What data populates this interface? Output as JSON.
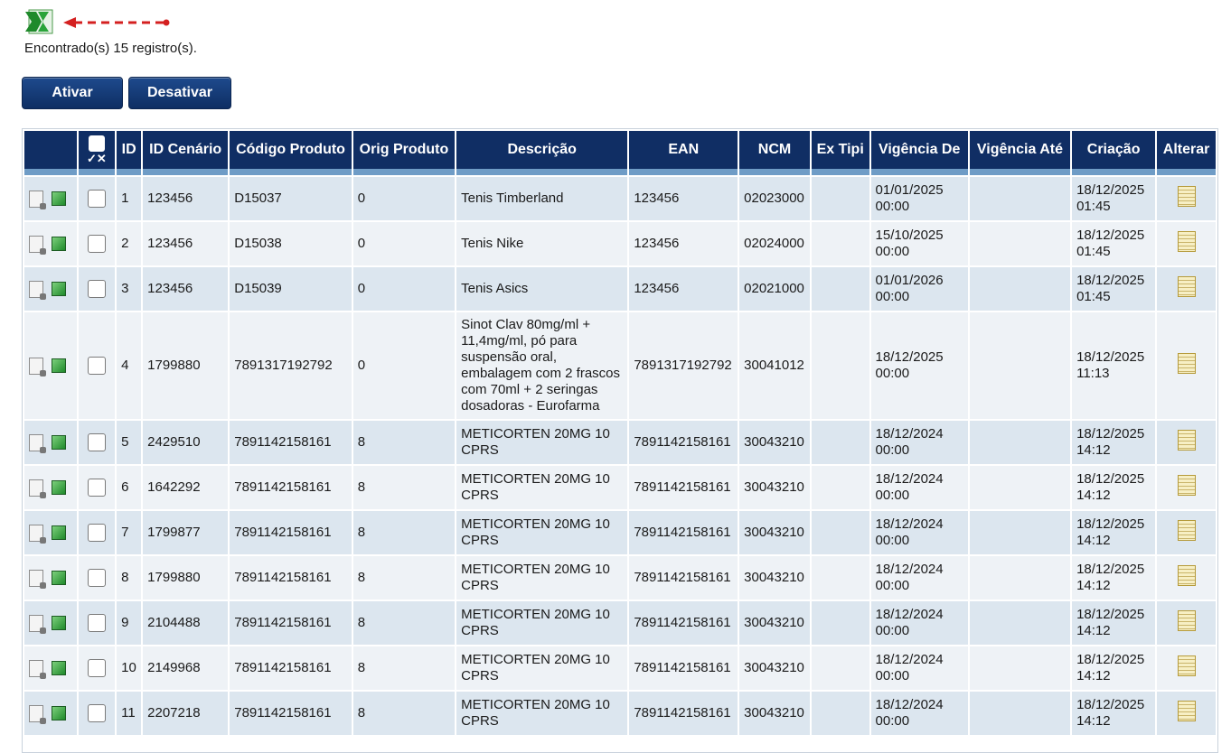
{
  "header": {
    "excel_icon": "excel-icon",
    "arrow_color": "#d42020",
    "found_text": "Encontrado(s) 15 registro(s)."
  },
  "actions": {
    "ativar_label": "Ativar",
    "desativar_label": "Desativar"
  },
  "table": {
    "columns": [
      "ID",
      "ID Cenário",
      "Código Produto",
      "Orig Produto",
      "Descrição",
      "EAN",
      "NCM",
      "Ex Tipi",
      "Vigência De",
      "Vigência Até",
      "Criação",
      "Alterar"
    ],
    "header_check_mark": "✓✕",
    "rows": [
      {
        "id": "1",
        "cenario": "123456",
        "codigo": "D15037",
        "orig": "0",
        "descricao": "Tenis Timberland",
        "ean": "123456",
        "ncm": "02023000",
        "extipi": "",
        "vig_de": "01/01/2025\n00:00",
        "vig_ate": "",
        "criacao": "18/12/2025\n01:45"
      },
      {
        "id": "2",
        "cenario": "123456",
        "codigo": "D15038",
        "orig": "0",
        "descricao": "Tenis Nike",
        "ean": "123456",
        "ncm": "02024000",
        "extipi": "",
        "vig_de": "15/10/2025\n00:00",
        "vig_ate": "",
        "criacao": "18/12/2025\n01:45"
      },
      {
        "id": "3",
        "cenario": "123456",
        "codigo": "D15039",
        "orig": "0",
        "descricao": "Tenis Asics",
        "ean": "123456",
        "ncm": "02021000",
        "extipi": "",
        "vig_de": "01/01/2026\n00:00",
        "vig_ate": "",
        "criacao": "18/12/2025\n01:45"
      },
      {
        "id": "4",
        "cenario": "1799880",
        "codigo": "7891317192792",
        "orig": "0",
        "descricao": "Sinot Clav 80mg/ml + 11,4mg/ml, pó para suspensão oral, embalagem com 2 frascos com 70ml + 2 seringas dosadoras - Eurofarma",
        "ean": "7891317192792",
        "ncm": "30041012",
        "extipi": "",
        "vig_de": "18/12/2025\n00:00",
        "vig_ate": "",
        "criacao": "18/12/2025\n11:13"
      },
      {
        "id": "5",
        "cenario": "2429510",
        "codigo": "7891142158161",
        "orig": "8",
        "descricao": "METICORTEN 20MG 10 CPRS",
        "ean": "7891142158161",
        "ncm": "30043210",
        "extipi": "",
        "vig_de": "18/12/2024\n00:00",
        "vig_ate": "",
        "criacao": "18/12/2025\n14:12"
      },
      {
        "id": "6",
        "cenario": "1642292",
        "codigo": "7891142158161",
        "orig": "8",
        "descricao": "METICORTEN 20MG 10 CPRS",
        "ean": "7891142158161",
        "ncm": "30043210",
        "extipi": "",
        "vig_de": "18/12/2024\n00:00",
        "vig_ate": "",
        "criacao": "18/12/2025\n14:12"
      },
      {
        "id": "7",
        "cenario": "1799877",
        "codigo": "7891142158161",
        "orig": "8",
        "descricao": "METICORTEN 20MG 10 CPRS",
        "ean": "7891142158161",
        "ncm": "30043210",
        "extipi": "",
        "vig_de": "18/12/2024\n00:00",
        "vig_ate": "",
        "criacao": "18/12/2025\n14:12"
      },
      {
        "id": "8",
        "cenario": "1799880",
        "codigo": "7891142158161",
        "orig": "8",
        "descricao": "METICORTEN 20MG 10 CPRS",
        "ean": "7891142158161",
        "ncm": "30043210",
        "extipi": "",
        "vig_de": "18/12/2024\n00:00",
        "vig_ate": "",
        "criacao": "18/12/2025\n14:12"
      },
      {
        "id": "9",
        "cenario": "2104488",
        "codigo": "7891142158161",
        "orig": "8",
        "descricao": "METICORTEN 20MG 10 CPRS",
        "ean": "7891142158161",
        "ncm": "30043210",
        "extipi": "",
        "vig_de": "18/12/2024\n00:00",
        "vig_ate": "",
        "criacao": "18/12/2025\n14:12"
      },
      {
        "id": "10",
        "cenario": "2149968",
        "codigo": "7891142158161",
        "orig": "8",
        "descricao": "METICORTEN 20MG 10 CPRS",
        "ean": "7891142158161",
        "ncm": "30043210",
        "extipi": "",
        "vig_de": "18/12/2024\n00:00",
        "vig_ate": "",
        "criacao": "18/12/2025\n14:12"
      },
      {
        "id": "11",
        "cenario": "2207218",
        "codigo": "7891142158161",
        "orig": "8",
        "descricao": "METICORTEN 20MG 10 CPRS",
        "ean": "7891142158161",
        "ncm": "30043210",
        "extipi": "",
        "vig_de": "18/12/2024\n00:00",
        "vig_ate": "",
        "criacao": "18/12/2025\n14:12"
      }
    ]
  }
}
